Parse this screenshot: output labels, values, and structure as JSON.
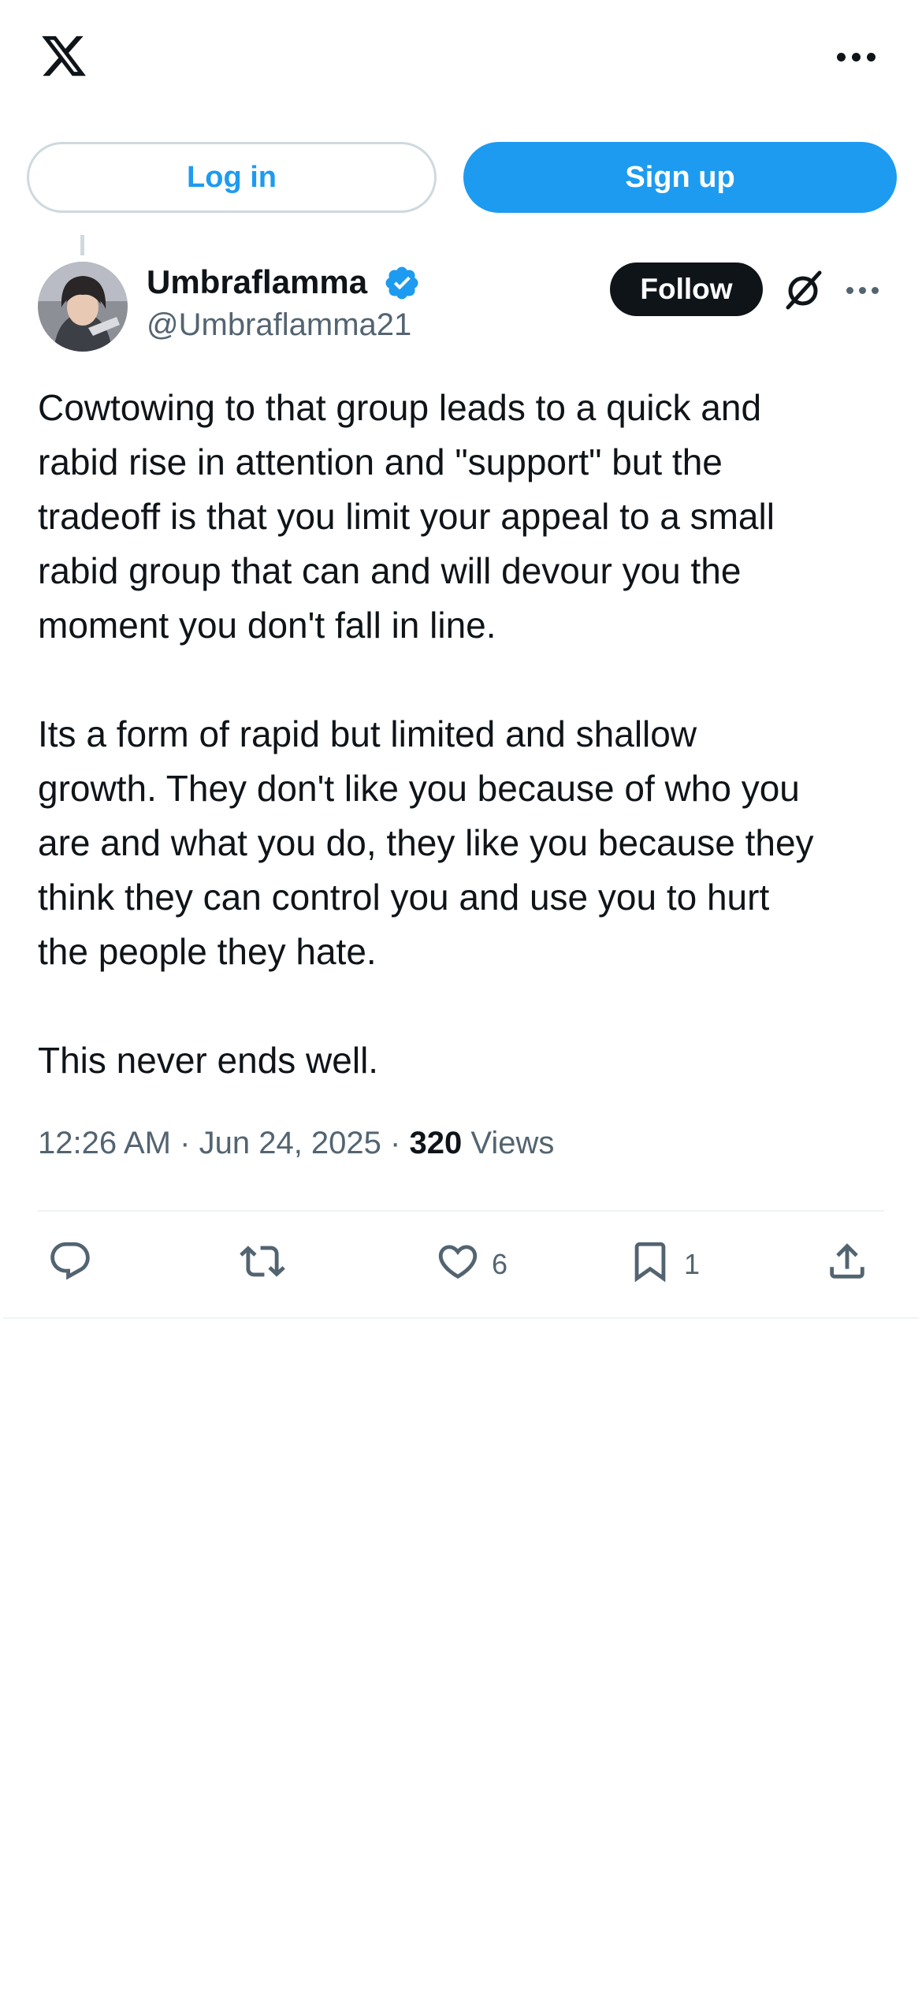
{
  "topbar": {
    "logo_icon": "x-logo-icon",
    "more_icon": "more-horizontal-icon"
  },
  "auth": {
    "login_label": "Log in",
    "signup_label": "Sign up"
  },
  "colors": {
    "accent": "#1d9bf0",
    "text": "#0f1419",
    "secondary": "#536471",
    "border": "#cfd9de"
  },
  "post": {
    "author": {
      "display_name": "Umbraflamma",
      "handle": "@Umbraflamma21",
      "verified": true
    },
    "follow_label": "Follow",
    "text": "Cowtowing to that group leads to a quick and\nrabid rise in attention and \"support\" but the\ntradeoff is that you limit your appeal to a small\nrabid group that can and will devour you the\nmoment you don't fall in line.\n\nIts a form of rapid but limited and shallow\ngrowth. They don't like you because of who you\nare and what you do, they like you because they\nthink they can control you and use you to hurt\nthe people they hate.\n\nThis never ends well.",
    "time": "12:26 AM",
    "sep1": "·",
    "date": "Jun 24, 2025",
    "sep2": "·",
    "views_count": "320",
    "views_label": "Views",
    "actions": {
      "reply": {
        "icon": "reply-icon"
      },
      "repost": {
        "icon": "repost-icon"
      },
      "like": {
        "icon": "heart-icon",
        "count": "6"
      },
      "bookmark": {
        "icon": "bookmark-icon",
        "count": "1"
      },
      "share": {
        "icon": "share-icon"
      }
    }
  }
}
